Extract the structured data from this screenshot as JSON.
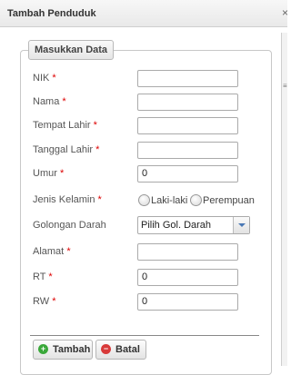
{
  "dialog": {
    "title": "Tambah Penduduk",
    "close_glyph": "×"
  },
  "form": {
    "legend": "Masukkan Data",
    "fields": {
      "nik": {
        "label": "NIK",
        "required": "*",
        "value": ""
      },
      "nama": {
        "label": "Nama",
        "required": "*",
        "value": ""
      },
      "tempat_lahir": {
        "label": "Tempat Lahir",
        "required": "*",
        "value": ""
      },
      "tanggal_lahir": {
        "label": "Tanggal Lahir",
        "required": "*",
        "value": ""
      },
      "umur": {
        "label": "Umur",
        "required": "*",
        "value": "0"
      },
      "jenis_kelamin": {
        "label": "Jenis Kelamin",
        "required": "*",
        "options": [
          "Laki-laki",
          "Perempuan"
        ]
      },
      "golongan_darah": {
        "label": "Golongan Darah",
        "selected": "Pilih Gol. Darah"
      },
      "alamat": {
        "label": "Alamat",
        "required": "*",
        "value": ""
      },
      "rt": {
        "label": "RT",
        "required": "*",
        "value": "0"
      },
      "rw": {
        "label": "RW",
        "required": "*",
        "value": "0"
      }
    }
  },
  "buttons": {
    "tambah": {
      "label": "Tambah",
      "icon": "plus-circle-icon",
      "color": "#3aa83a"
    },
    "batal": {
      "label": "Batal",
      "icon": "minus-circle-icon",
      "color": "#d83a3a"
    }
  },
  "colors": {
    "required_marker": "#dd0000",
    "select_arrow": "#4a78b5"
  }
}
